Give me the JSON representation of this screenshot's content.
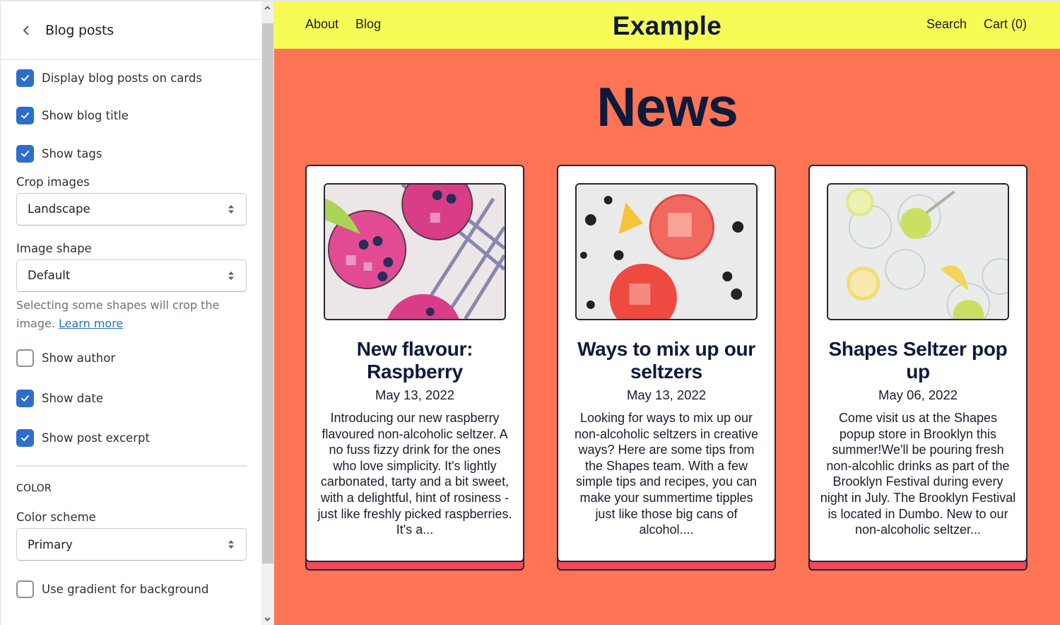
{
  "sidebar": {
    "title": "Blog posts",
    "checkboxes_top": [
      {
        "label": "Display blog posts on cards",
        "checked": true
      },
      {
        "label": "Show blog title",
        "checked": true
      },
      {
        "label": "Show tags",
        "checked": true
      }
    ],
    "crop_images": {
      "label": "Crop images",
      "value": "Landscape"
    },
    "image_shape": {
      "label": "Image shape",
      "value": "Default",
      "help_text": "Selecting some shapes will crop the image.",
      "help_link": "Learn more"
    },
    "checkboxes_mid": [
      {
        "label": "Show author",
        "checked": false
      },
      {
        "label": "Show date",
        "checked": true
      },
      {
        "label": "Show post excerpt",
        "checked": true
      }
    ],
    "color_section": {
      "heading": "COLOR",
      "scheme_label": "Color scheme",
      "scheme_value": "Primary",
      "gradient_label": "Use gradient for background",
      "gradient_checked": false
    }
  },
  "preview": {
    "nav_left": [
      "About",
      "Blog"
    ],
    "logo": "Example",
    "nav_right": [
      "Search",
      "Cart (0)"
    ],
    "page_title": "News",
    "colors": {
      "header_bg": "#f7fb55",
      "page_bg": "#fe7455",
      "card_shadow": "#ef4a5b",
      "text": "#0d1a3c",
      "checkbox_accent": "#2c6ecb"
    },
    "posts": [
      {
        "image": "raspberry-drinks-photo",
        "title": "New flavour: Raspberry",
        "date": "May 13, 2022",
        "excerpt": "Introducing our new raspberry flavoured non-alcoholic seltzer.   A no fuss fizzy drink for the ones who love simplicity. It's lightly carbonated, tarty and a bit sweet, with a delightful, hint of rosiness - just like freshly picked raspberries. It's a..."
      },
      {
        "image": "red-drinks-blackberries-photo",
        "title": "Ways to mix up our seltzers",
        "date": "May 13, 2022",
        "excerpt": "Looking for ways to mix up our non-alcoholic seltzers in creative ways? Here are some tips from the Shapes team. With a few simple tips and recipes, you can make your summertime tipples just like those big cans of alcohol...."
      },
      {
        "image": "lemon-water-glasses-photo",
        "title": "Shapes Seltzer pop up",
        "date": "May 06, 2022",
        "excerpt": "Come visit us at the Shapes popup store in Brooklyn this summer!We'll be pouring fresh non-alcohlic drinks as part of the Brooklyn Festival during every night in July. The Brooklyn Festival is located in Dumbo. New to our non-alcoholic seltzer..."
      }
    ]
  }
}
